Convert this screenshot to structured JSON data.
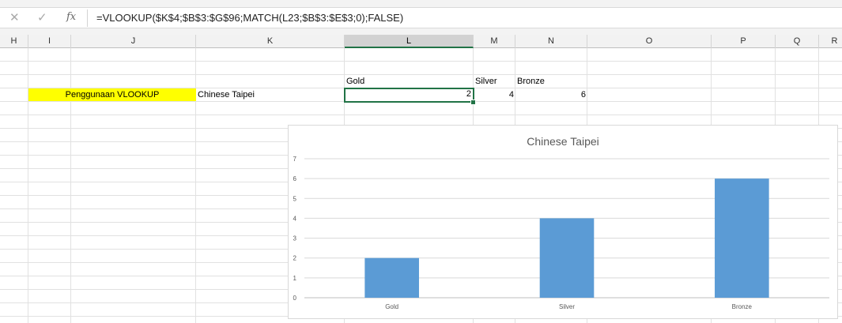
{
  "formula_bar": {
    "cancel_icon": "close-icon",
    "enter_icon": "check-icon",
    "fx_label": "fx",
    "formula": "=VLOOKUP($K$4;$B$3:$G$96;MATCH(L23;$B$3:$E$3;0);FALSE)"
  },
  "columns": [
    "H",
    "I",
    "J",
    "K",
    "L",
    "M",
    "N",
    "O",
    "P",
    "Q",
    "R"
  ],
  "selected_column": "L",
  "cells": {
    "L5": "Gold",
    "M5": "Silver",
    "N5": "Bronze",
    "J6": "Penggunaan VLOOKUP",
    "K6": "Chinese Taipei",
    "L6": "2",
    "M6": "4",
    "N6": "6"
  },
  "colors": {
    "highlight": "#ffff00",
    "selection": "#217346",
    "bar": "#5b9bd5"
  },
  "chart_data": {
    "type": "bar",
    "title": "Chinese Taipei",
    "categories": [
      "Gold",
      "Silver",
      "Bronze"
    ],
    "values": [
      2,
      4,
      6
    ],
    "ylim": [
      0,
      7
    ],
    "yticks": [
      0,
      1,
      2,
      3,
      4,
      5,
      6,
      7
    ],
    "xlabel": "",
    "ylabel": "",
    "grid": true,
    "legend": "none"
  }
}
